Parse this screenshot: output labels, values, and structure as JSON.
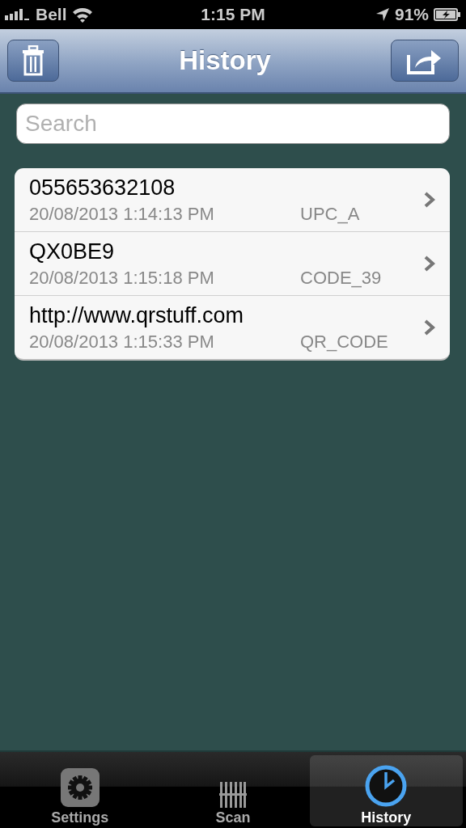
{
  "status_bar": {
    "carrier": "Bell",
    "time": "1:15 PM",
    "battery": "91%"
  },
  "nav_bar": {
    "title": "History"
  },
  "search": {
    "placeholder": "Search"
  },
  "history": [
    {
      "value": "055653632108",
      "date": "20/08/2013 1:14:13 PM",
      "format": "UPC_A"
    },
    {
      "value": "QX0BE9",
      "date": "20/08/2013 1:15:18 PM",
      "format": "CODE_39"
    },
    {
      "value": "http://www.qrstuff.com",
      "date": "20/08/2013 1:15:33 PM",
      "format": "QR_CODE"
    }
  ],
  "tabs": [
    {
      "kind": "settings",
      "label": "Settings",
      "selected": false
    },
    {
      "kind": "scan",
      "label": "Scan",
      "selected": false
    },
    {
      "kind": "history",
      "label": "History",
      "selected": true
    }
  ]
}
